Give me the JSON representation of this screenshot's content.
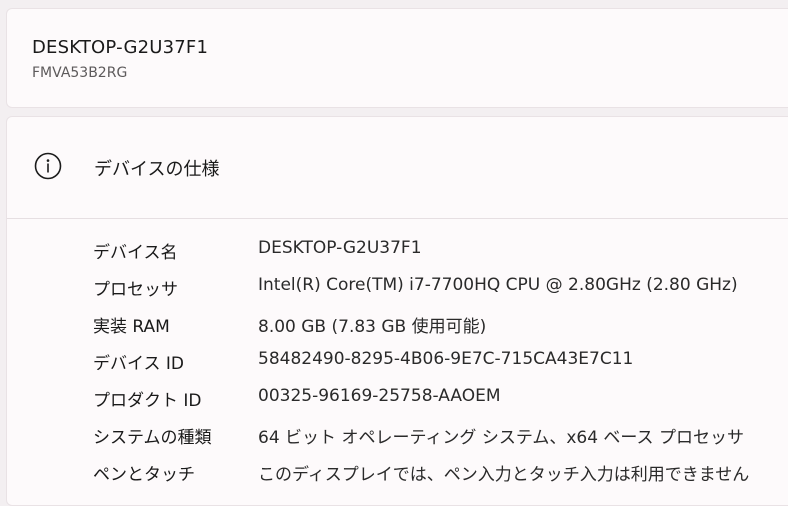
{
  "device": {
    "name": "DESKTOP-G2U37F1",
    "model": "FMVA53B2RG"
  },
  "specs": {
    "title": "デバイスの仕様",
    "icon": "info-icon",
    "rows": [
      {
        "label": "デバイス名",
        "value": "DESKTOP-G2U37F1"
      },
      {
        "label": "プロセッサ",
        "value": "Intel(R) Core(TM) i7-7700HQ CPU @ 2.80GHz (2.80 GHz)"
      },
      {
        "label": "実装 RAM",
        "value": "8.00 GB (7.83 GB 使用可能)"
      },
      {
        "label": "デバイス ID",
        "value": "58482490-8295-4B06-9E7C-715CA43E7C11"
      },
      {
        "label": "プロダクト ID",
        "value": "00325-96169-25758-AAOEM"
      },
      {
        "label": "システムの種類",
        "value": "64 ビット オペレーティング システム、x64 ベース プロセッサ"
      },
      {
        "label": "ペンとタッチ",
        "value": "このディスプレイでは、ペン入力とタッチ入力は利用できません"
      }
    ]
  }
}
